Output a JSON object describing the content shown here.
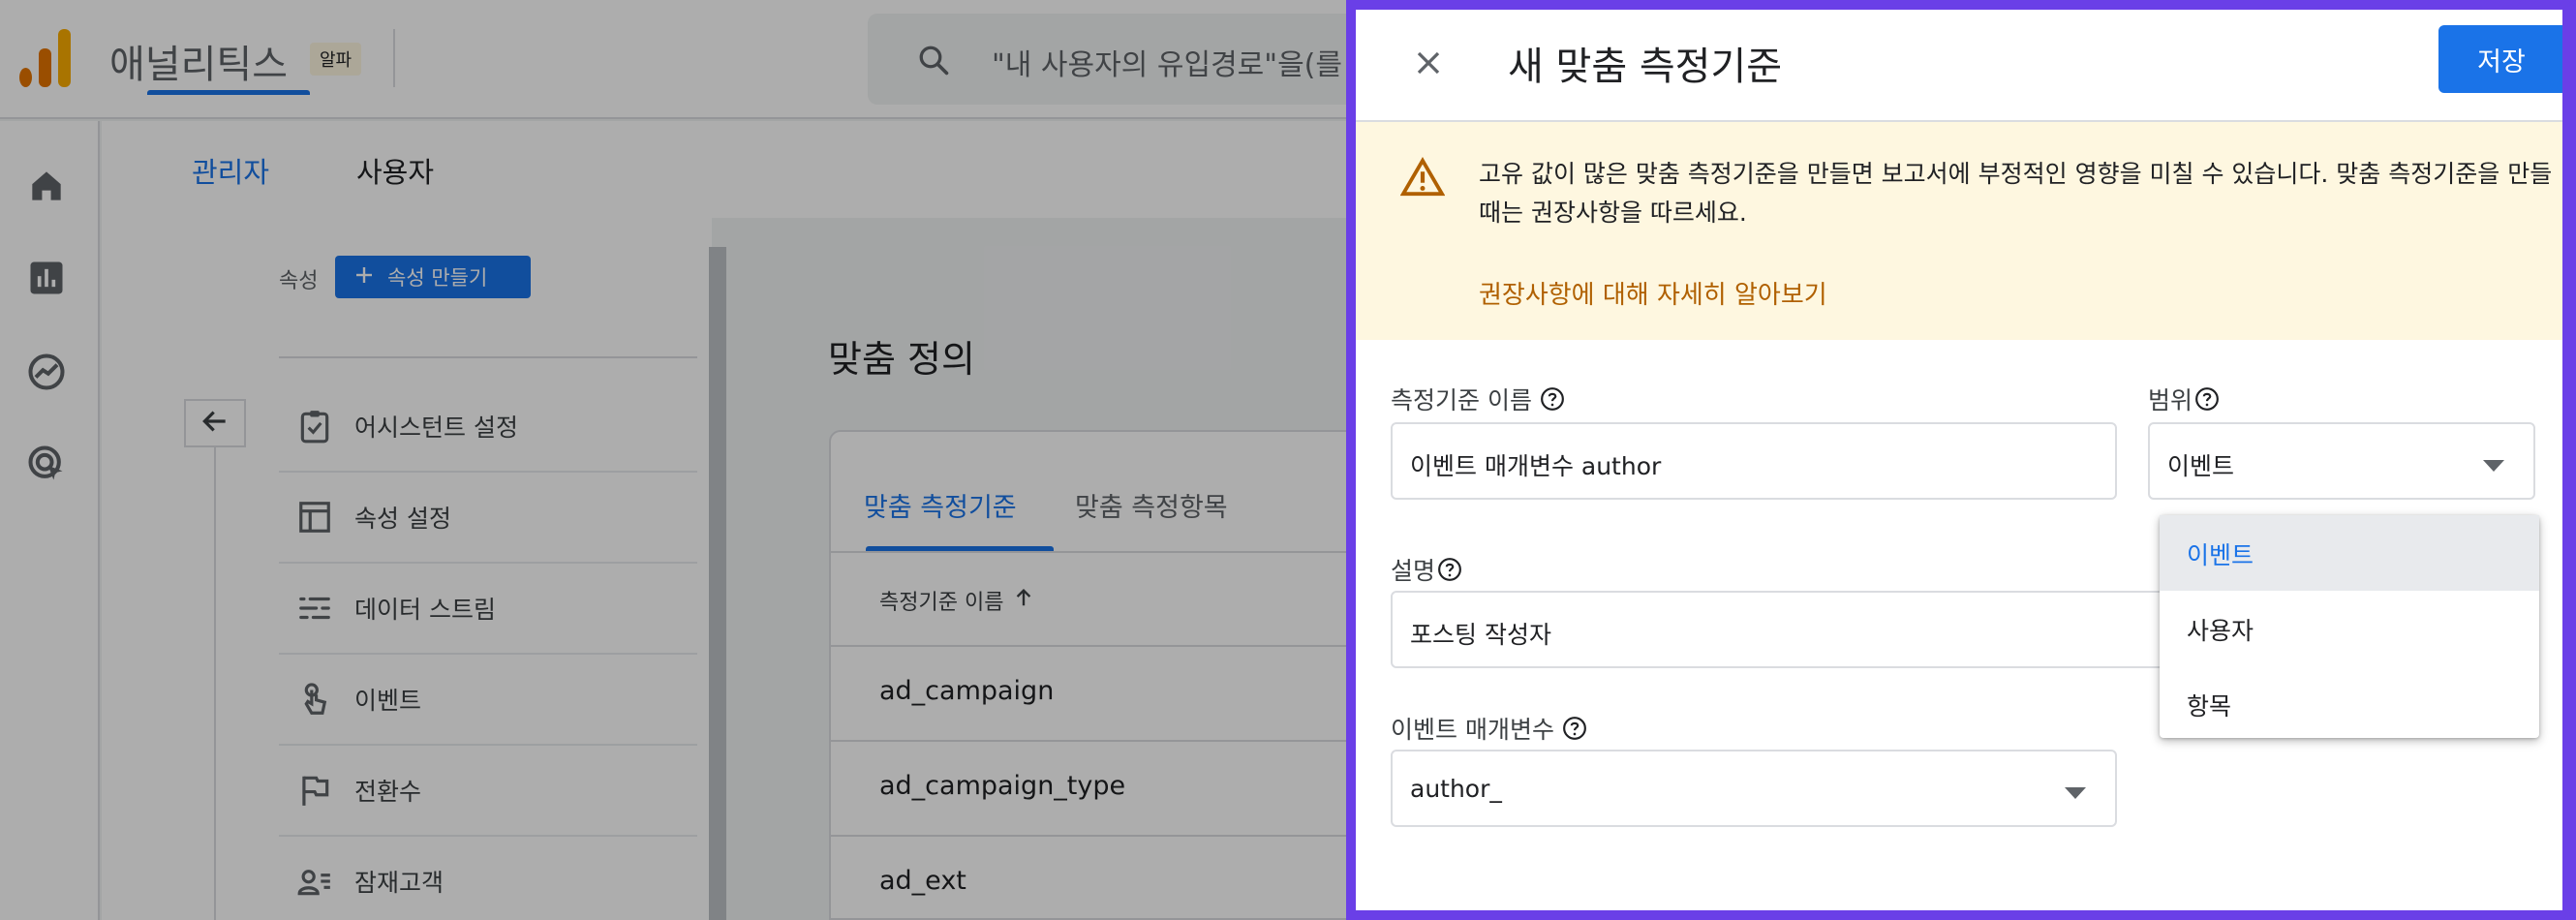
{
  "app": {
    "title": "애널리틱스",
    "badge": "알파",
    "search_placeholder": "\"내 사용자의 유입경로\"을(를 검색해 보세요"
  },
  "admin_tabs": [
    {
      "label": "관리자",
      "active": true
    },
    {
      "label": "사용자",
      "active": false
    }
  ],
  "property": {
    "label": "속성",
    "create_button": "속성 만들기"
  },
  "menu": [
    {
      "label": "어시스턴트 설정",
      "icon": "clipboard-check-icon"
    },
    {
      "label": "속성 설정",
      "icon": "layout-icon"
    },
    {
      "label": "데이터 스트림",
      "icon": "data-stream-icon"
    },
    {
      "label": "이벤트",
      "icon": "touch-icon"
    },
    {
      "label": "전환수",
      "icon": "flag-icon"
    },
    {
      "label": "잠재고객",
      "icon": "audience-icon"
    }
  ],
  "section_title": "맞춤 정의",
  "card": {
    "tabs": [
      {
        "label": "맞춤 측정기준",
        "active": true
      },
      {
        "label": "맞춤 측정항목",
        "active": false
      }
    ],
    "column_header": "측정기준 이름",
    "rows": [
      "ad_campaign",
      "ad_campaign_type",
      "ad_ext"
    ]
  },
  "panel": {
    "title": "새 맞춤 측정기준",
    "save_label": "저장",
    "warning_text": "고유 값이 많은 맞춤 측정기준을 만들면 보고서에 부정적인 영향을 미칠 수 있습니다. 맞춤 측정기준을 만들 때는 권장사항을 따르세요.",
    "warning_link": "권장사항에 대해 자세히 알아보기",
    "dimension_name_label": "측정기준 이름",
    "dimension_name_value": "이벤트 매개변수 author",
    "scope_label": "범위",
    "scope_value": "이벤트",
    "description_label": "설명",
    "description_value": "포스팅 작성자",
    "event_param_label": "이벤트 매개변수",
    "event_param_value": "author_",
    "scope_options": [
      {
        "label": "이벤트",
        "selected": true
      },
      {
        "label": "사용자",
        "selected": false
      },
      {
        "label": "항목",
        "selected": false
      }
    ]
  },
  "colors": {
    "accent": "#1a73e8",
    "panel_border": "#6a3fe7",
    "warning_bg": "#fef7e0",
    "warning_link": "#b06000"
  }
}
